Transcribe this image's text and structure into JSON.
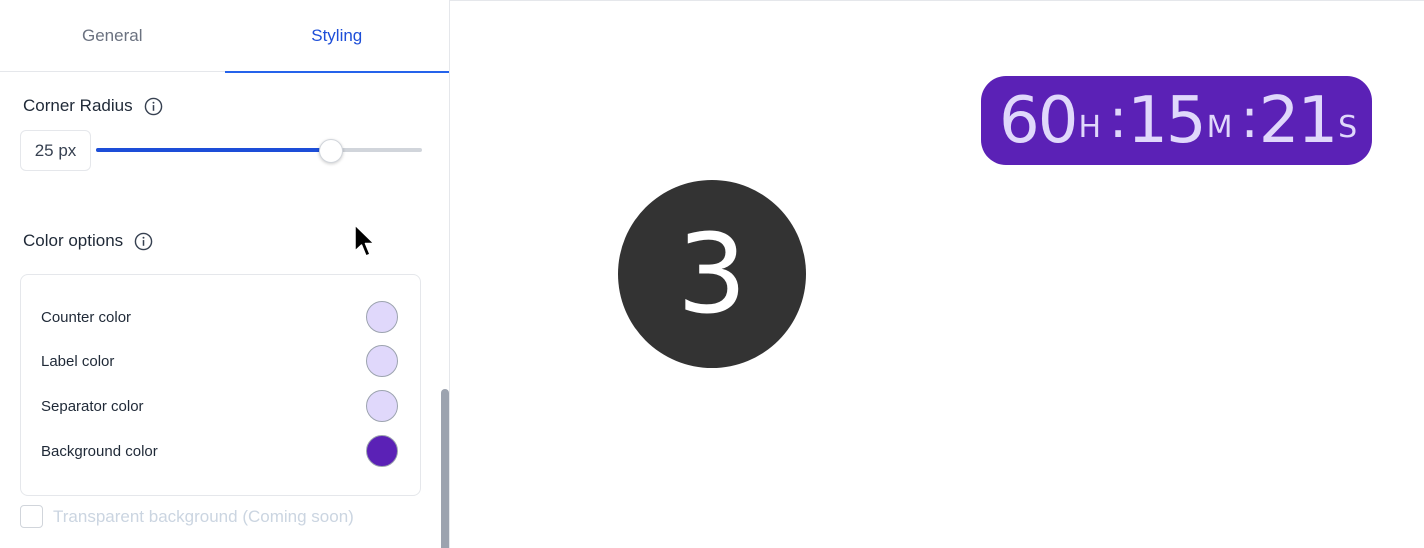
{
  "tabs": [
    {
      "label": "General",
      "active": false
    },
    {
      "label": "Styling",
      "active": true
    }
  ],
  "corner_radius": {
    "label": "Corner Radius",
    "value_text": "25 px",
    "slider_fraction": 0.72
  },
  "color_options": {
    "label": "Color options",
    "rows": [
      {
        "label": "Counter color",
        "color": "#e0d8fb"
      },
      {
        "label": "Label color",
        "color": "#e0d8fb"
      },
      {
        "label": "Separator color",
        "color": "#e0d8fb"
      },
      {
        "label": "Background color",
        "color": "#5b21b6"
      }
    ]
  },
  "transparent_background": {
    "label": "Transparent background (Coming soon)",
    "checked": false
  },
  "preview": {
    "timer": {
      "hours": "60",
      "hours_unit": "H",
      "minutes": "15",
      "minutes_unit": "M",
      "seconds": "21",
      "seconds_unit": "S",
      "separator": ":",
      "background": "#5b21b6",
      "text_color": "#e0d8fb"
    },
    "step_badge": "3"
  },
  "accent_color": "#1d4ed8"
}
